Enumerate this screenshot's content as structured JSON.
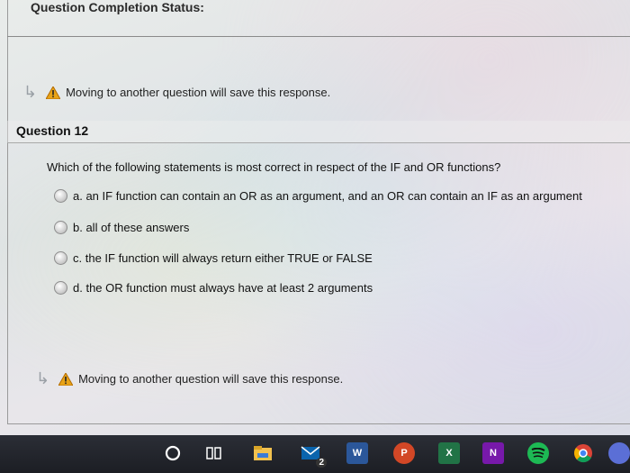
{
  "header": {
    "status_title": "Question Completion Status:"
  },
  "notice": {
    "text": "Moving to another question will save this response."
  },
  "question": {
    "number": "Question 12",
    "prompt": "Which of the following statements is most correct in respect of the IF and OR functions?",
    "options": [
      "a. an IF function can contain an OR as an argument, and an OR can contain an IF as an argument",
      "b. all of these answers",
      "c. the IF function will always return either TRUE or FALSE",
      "d. the OR function must always have at least 2 arguments"
    ]
  },
  "taskbar": {
    "icons": [
      "cortana-icon",
      "task-view-icon",
      "file-explorer-icon",
      "mail-icon",
      "word-icon",
      "powerpoint-icon",
      "excel-icon",
      "onenote-icon",
      "spotify-icon",
      "chrome-icon"
    ],
    "labels": {
      "word": "W",
      "powerpoint": "P",
      "excel": "X",
      "onenote": "N",
      "mail_badge": "2"
    },
    "colors": {
      "word": "#2b579a",
      "powerpoint": "#d24726",
      "excel": "#217346",
      "onenote": "#7719aa",
      "spotify": "#1db954",
      "explorer": "#f2c14e",
      "mail": "#0a64ad"
    }
  }
}
